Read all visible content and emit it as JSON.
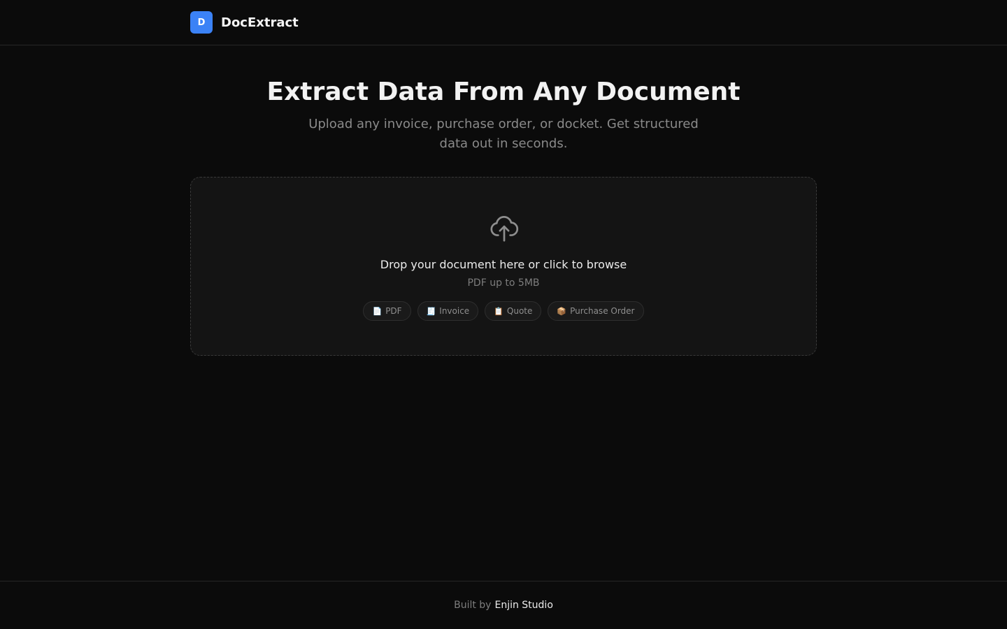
{
  "header": {
    "logo_letter": "D",
    "app_name": "DocExtract"
  },
  "hero": {
    "title": "Extract Data From Any Document",
    "subtitle": "Upload any invoice, purchase order, or docket. Get structured data out in seconds."
  },
  "dropzone": {
    "icon": "upload-cloud-icon",
    "title": "Drop your document here or click to browse",
    "hint": "PDF up to 5MB",
    "chips": [
      {
        "icon": "📄",
        "label": "PDF"
      },
      {
        "icon": "🧾",
        "label": "Invoice"
      },
      {
        "icon": "📋",
        "label": "Quote"
      },
      {
        "icon": "📦",
        "label": "Purchase Order"
      }
    ]
  },
  "footer": {
    "prefix": "Built by",
    "link": "Enjin Studio"
  },
  "colors": {
    "background": "#0b0b0b",
    "accent": "#3b82f6",
    "panel": "#141414"
  }
}
